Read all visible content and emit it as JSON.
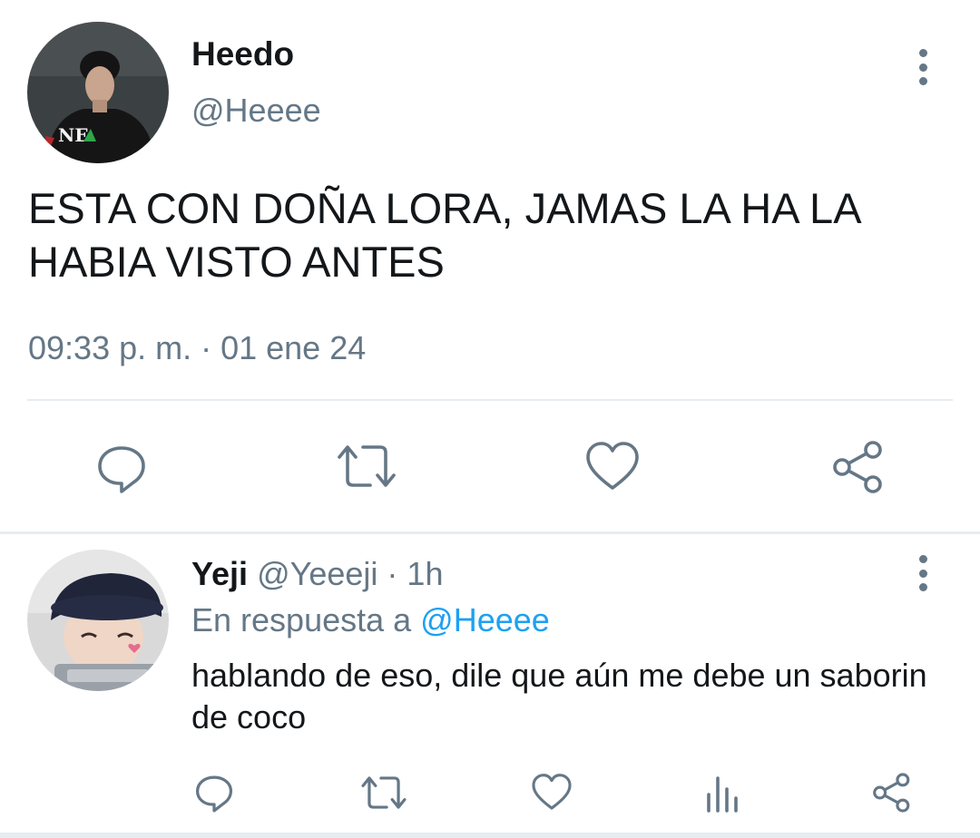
{
  "main_tweet": {
    "author_name": "Heedo",
    "author_handle": "@Heeee",
    "text": "ESTA CON DOÑA LORA, JAMAS LA HA LA HABIA VISTO ANTES",
    "timestamp": "09:33 p. m. · 01 ene 24",
    "avatar_text": "NE",
    "actions": [
      "reply-icon",
      "retweet-icon",
      "like-icon",
      "share-icon"
    ]
  },
  "reply_tweet": {
    "author_name": "Yeji",
    "author_handle": "@Yeeeji",
    "separator": "·",
    "time": "1h",
    "reply_to_label": "En respuesta a",
    "reply_to_handle": "@Heeee",
    "text": "hablando de eso, dile que aún me debe un saborin de coco",
    "actions": [
      "reply-icon",
      "retweet-icon",
      "like-icon",
      "analytics-icon",
      "share-icon"
    ]
  },
  "colors": {
    "text_primary": "#14171a",
    "text_secondary": "#657786",
    "link": "#1da1f2",
    "divider": "#e6ecf0",
    "icon": "#657786"
  }
}
